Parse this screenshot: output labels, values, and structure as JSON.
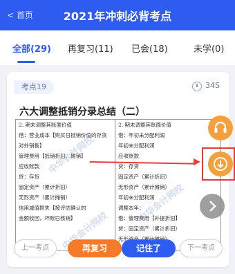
{
  "header": {
    "back_label": "< 首页",
    "title": "2021年冲刺必背考点",
    "bg_color": "#2e5bf0"
  },
  "tabs": [
    {
      "label": "全部(29)",
      "active": true
    },
    {
      "label": "再复习(11)",
      "active": false
    },
    {
      "label": "已会(18)",
      "active": false
    },
    {
      "label": "未学(0)",
      "active": false
    }
  ],
  "card": {
    "badge": "考点19",
    "timer": "34S",
    "title": "六大调整抵销分录总结（二）",
    "doc": {
      "left_lines": [
        "2. 期末调整其账面价值",
        "借：营业成本【购买日抵销价值的存货",
        "    对外销售】",
        "    管理费用【抵销折旧、摊销】",
        "    应收账款",
        "    贷：存货",
        "        固定资产（累计折旧）",
        "        无形资产（累计摊销）",
        "        信用减值损失【按评估确认的",
        "        金额收回，坏账已核销】"
      ],
      "right_lines": [
        "2. 期末调整其账面价值",
        "借：年初未分配利润",
        "    年初未分配利润",
        "    应收账款",
        "    贷：存货",
        "        固定资产（累计折旧）",
        "        无形资产（累计摊销）",
        "        年初未分配利润",
        "调整本年：",
        "借：管理费用【补提折旧】",
        "    贷：固定资产（累计折旧）",
        "        无形资产（累计摊销）"
      ],
      "watermark": "中华会计网校"
    },
    "buttons": {
      "prev": "上一考点",
      "review": "再复习",
      "remember": "记住了",
      "next": "下一考点"
    }
  },
  "fab_icons": {
    "service": "headset-icon",
    "download": "download-icon",
    "next": "chevron-right-icon"
  },
  "colors": {
    "accent": "#2e5bf0",
    "orange": "#f57a2a",
    "highlight": "#e53b3b"
  }
}
